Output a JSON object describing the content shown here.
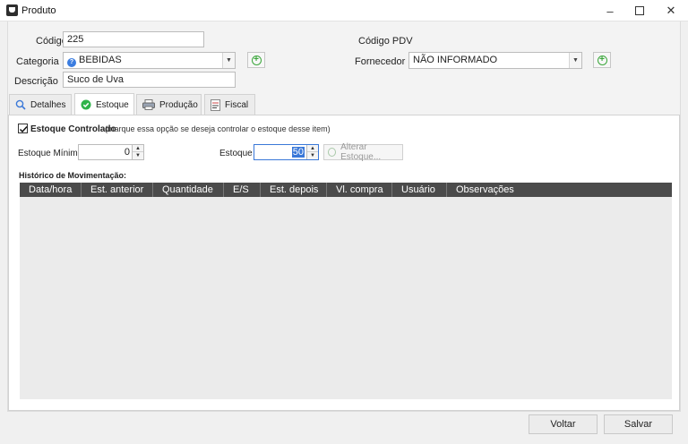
{
  "window": {
    "title": "Produto",
    "minimize": "–",
    "maximize": "☐",
    "close": "✕"
  },
  "form": {
    "codigo_label": "Código",
    "codigo_value": "225",
    "codigo_pdv_label": "Código PDV",
    "categoria_label": "Categoria",
    "categoria_value": "BEBIDAS",
    "fornecedor_label": "Fornecedor",
    "fornecedor_value": "NÃO INFORMADO",
    "descricao_label": "Descrição",
    "descricao_value": "Suco de Uva"
  },
  "tabs": [
    {
      "label": "Detalhes",
      "icon": "magnifier-icon"
    },
    {
      "label": "Estoque",
      "icon": "check-circle-icon",
      "active": true
    },
    {
      "label": "Produção",
      "icon": "printer-icon"
    },
    {
      "label": "Fiscal",
      "icon": "fiscal-document-icon"
    }
  ],
  "estoque": {
    "controlado_label": "Estoque Controlado",
    "controlado_hint": "(marque essa opção se deseja controlar o estoque desse item)",
    "controlado_checked": true,
    "minimo_label": "Estoque Mínimo",
    "minimo_value": "0",
    "estoque_label": "Estoque",
    "estoque_value": "50",
    "alterar_button": "Alterar Estoque...",
    "historico_label": "Histórico de Movimentação:"
  },
  "grid": {
    "columns": [
      "Data/hora",
      "Est. anterior",
      "Quantidade",
      "E/S",
      "Est. depois",
      "Vl. compra",
      "Usuário",
      "Observações"
    ],
    "rows": []
  },
  "footer": {
    "voltar": "Voltar",
    "salvar": "Salvar"
  },
  "colors": {
    "accent": "#3a78d8",
    "grid_header": "#4b4b4b",
    "add_green": "#3aa63a",
    "check_green": "#2fb34a"
  }
}
